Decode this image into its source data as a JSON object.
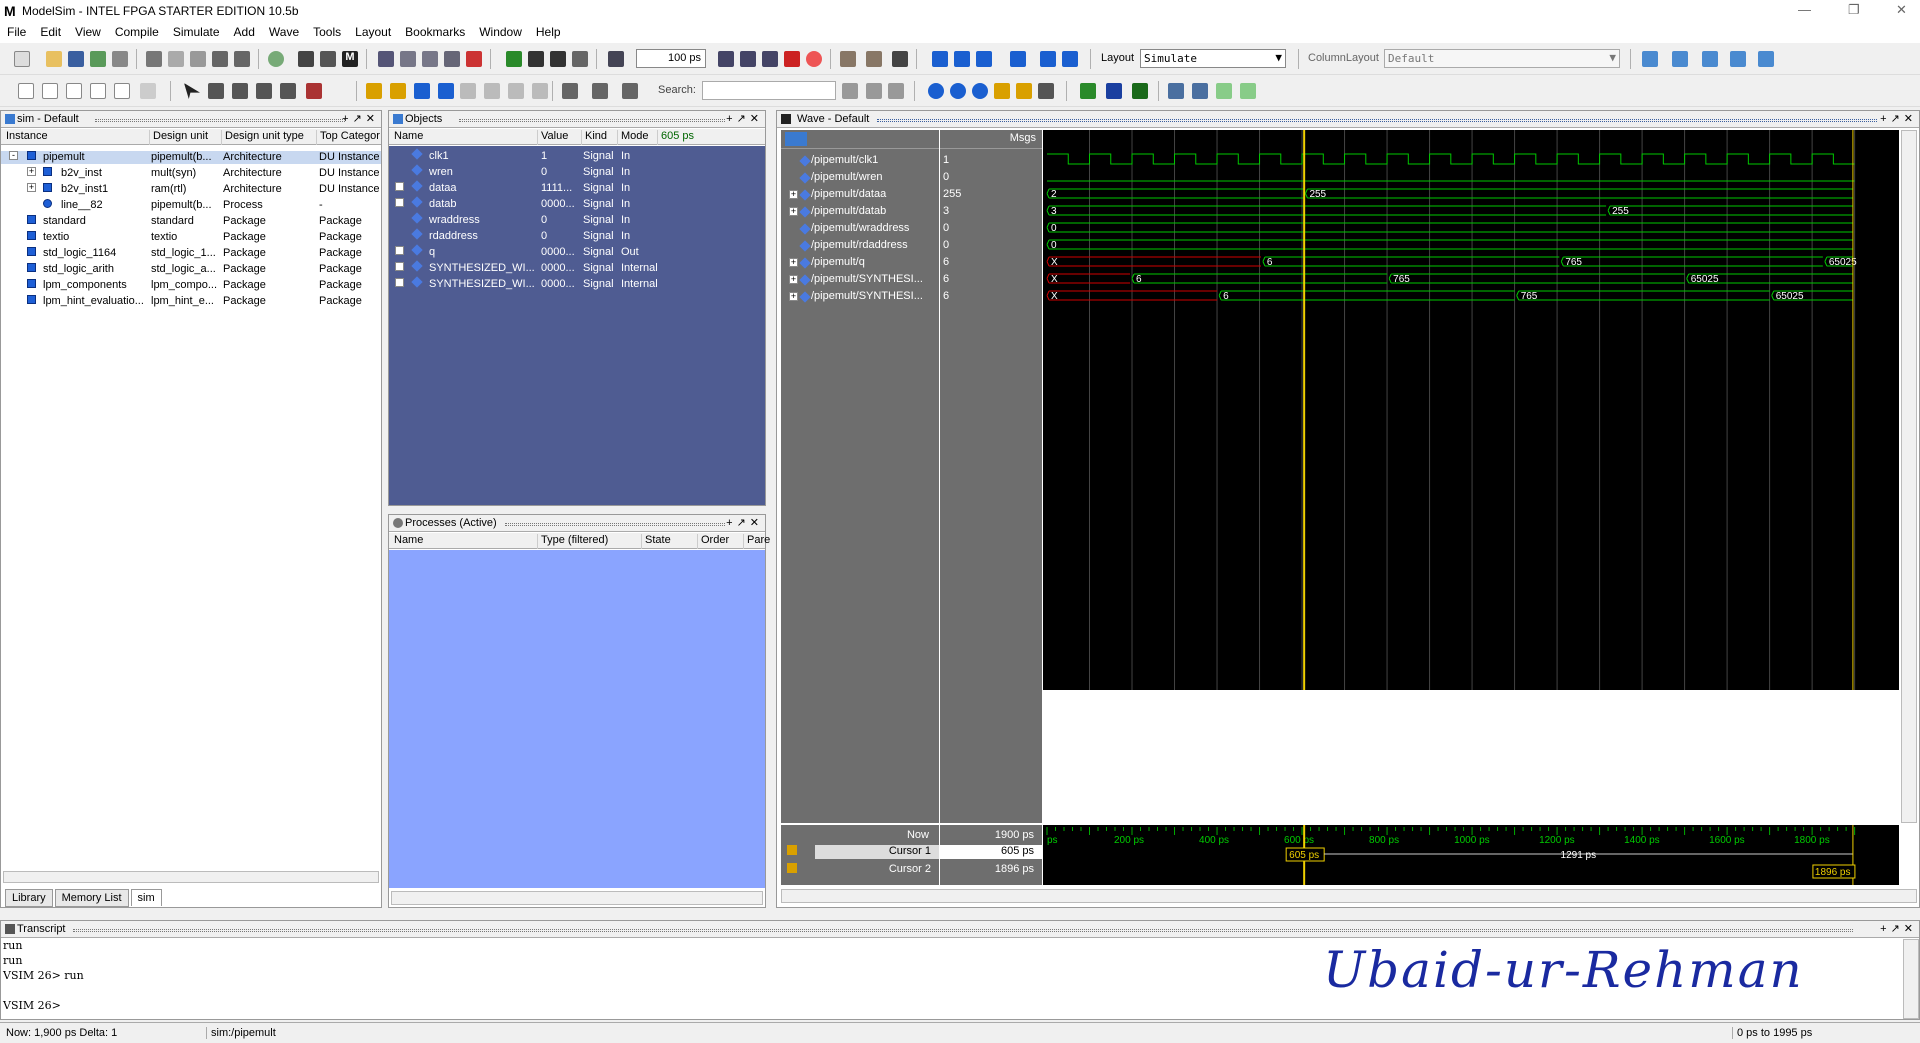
{
  "app": {
    "title": "ModelSim - INTEL FPGA STARTER EDITION 10.5b",
    "logo": "M"
  },
  "menu": [
    "File",
    "Edit",
    "View",
    "Compile",
    "Simulate",
    "Add",
    "Wave",
    "Tools",
    "Layout",
    "Bookmarks",
    "Window",
    "Help"
  ],
  "toolbar": {
    "run_length": "100 ps",
    "layout_label": "Layout",
    "layout_value": "Simulate",
    "column_layout_label": "ColumnLayout",
    "column_layout_value": "Default",
    "search_label": "Search:",
    "search_placeholder": ""
  },
  "sim_pane": {
    "title": "sim - Default",
    "columns": [
      "Instance",
      "Design unit",
      "Design unit type",
      "Top Categor"
    ],
    "rows": [
      {
        "instance": "pipemult",
        "unit": "pipemult(b...",
        "type": "Architecture",
        "cat": "DU Instance"
      },
      {
        "instance": "b2v_inst",
        "unit": "mult(syn)",
        "type": "Architecture",
        "cat": "DU Instance"
      },
      {
        "instance": "b2v_inst1",
        "unit": "ram(rtl)",
        "type": "Architecture",
        "cat": "DU Instance"
      },
      {
        "instance": "line__82",
        "unit": "pipemult(b...",
        "type": "Process",
        "cat": "-"
      },
      {
        "instance": "standard",
        "unit": "standard",
        "type": "Package",
        "cat": "Package"
      },
      {
        "instance": "textio",
        "unit": "textio",
        "type": "Package",
        "cat": "Package"
      },
      {
        "instance": "std_logic_1164",
        "unit": "std_logic_1...",
        "type": "Package",
        "cat": "Package"
      },
      {
        "instance": "std_logic_arith",
        "unit": "std_logic_a...",
        "type": "Package",
        "cat": "Package"
      },
      {
        "instance": "lpm_components",
        "unit": "lpm_compo...",
        "type": "Package",
        "cat": "Package"
      },
      {
        "instance": "lpm_hint_evaluatio...",
        "unit": "lpm_hint_e...",
        "type": "Package",
        "cat": "Package"
      }
    ],
    "tabs": [
      "Library",
      "Memory List",
      "sim"
    ]
  },
  "objects_pane": {
    "title": "Objects",
    "columns": [
      "Name",
      "Value",
      "Kind",
      "Mode"
    ],
    "time_field": "605 ps",
    "rows": [
      {
        "name": "clk1",
        "value": "1",
        "kind": "Signal",
        "mode": "In"
      },
      {
        "name": "wren",
        "value": "0",
        "kind": "Signal",
        "mode": "In"
      },
      {
        "name": "dataa",
        "value": "1111...",
        "kind": "Signal",
        "mode": "In"
      },
      {
        "name": "datab",
        "value": "0000...",
        "kind": "Signal",
        "mode": "In"
      },
      {
        "name": "wraddress",
        "value": "0",
        "kind": "Signal",
        "mode": "In"
      },
      {
        "name": "rdaddress",
        "value": "0",
        "kind": "Signal",
        "mode": "In"
      },
      {
        "name": "q",
        "value": "0000...",
        "kind": "Signal",
        "mode": "Out"
      },
      {
        "name": "SYNTHESIZED_WI...",
        "value": "0000...",
        "kind": "Signal",
        "mode": "Internal"
      },
      {
        "name": "SYNTHESIZED_WI...",
        "value": "0000...",
        "kind": "Signal",
        "mode": "Internal"
      }
    ]
  },
  "processes_pane": {
    "title": "Processes (Active)",
    "columns": [
      "Name",
      "Type (filtered)",
      "State",
      "Order",
      "Pare"
    ]
  },
  "wave_pane": {
    "title": "Wave - Default",
    "msgs_header": "Msgs",
    "signals": [
      {
        "name": "/pipemult/clk1",
        "value": "1"
      },
      {
        "name": "/pipemult/wren",
        "value": "0"
      },
      {
        "name": "/pipemult/dataa",
        "value": "255"
      },
      {
        "name": "/pipemult/datab",
        "value": "3"
      },
      {
        "name": "/pipemult/wraddress",
        "value": "0"
      },
      {
        "name": "/pipemult/rdaddress",
        "value": "0"
      },
      {
        "name": "/pipemult/q",
        "value": "6"
      },
      {
        "name": "/pipemult/SYNTHESI...",
        "value": "6"
      },
      {
        "name": "/pipemult/SYNTHESI...",
        "value": "6"
      }
    ],
    "bus_labels": {
      "dataa": [
        "2",
        "255"
      ],
      "datab": [
        "3",
        "255"
      ],
      "wraddress": [
        "0"
      ],
      "rdaddress": [
        "0"
      ],
      "q": [
        "X",
        "6",
        "765",
        "65025"
      ],
      "synth1": [
        "X",
        "6",
        "765",
        "65025"
      ],
      "synth2": [
        "X",
        "6",
        "765",
        "65025"
      ]
    },
    "now_label": "Now",
    "now_value": "1900 ps",
    "cursor1_label": "Cursor 1",
    "cursor1_value": "605 ps",
    "cursor2_label": "Cursor 2",
    "cursor2_value": "1896 ps",
    "cursor1_marker": "605 ps",
    "cursor2_marker": "1896 ps",
    "delta_label": "1291 ps",
    "axis_ticks": [
      "ps",
      "200 ps",
      "400 ps",
      "600 ps",
      "800 ps",
      "1000 ps",
      "1200 ps",
      "1400 ps",
      "1600 ps",
      "1800 ps"
    ]
  },
  "transcript": {
    "title": "Transcript",
    "lines": [
      "run",
      "run",
      "VSIM 26> run",
      "",
      "VSIM 26>"
    ],
    "signature": "Ubaid-ur-Rehman"
  },
  "status": {
    "now": "Now: 1,900 ps  Delta: 1",
    "context": "sim:/pipemult",
    "range": "0 ps to 1995 ps"
  },
  "colors": {
    "wave_green": "#00c800",
    "cursor_yellow": "#f0d000",
    "undefined_red": "#d00000",
    "objects_bg": "#4f5c92",
    "processes_bg": "#8aa4ff"
  }
}
